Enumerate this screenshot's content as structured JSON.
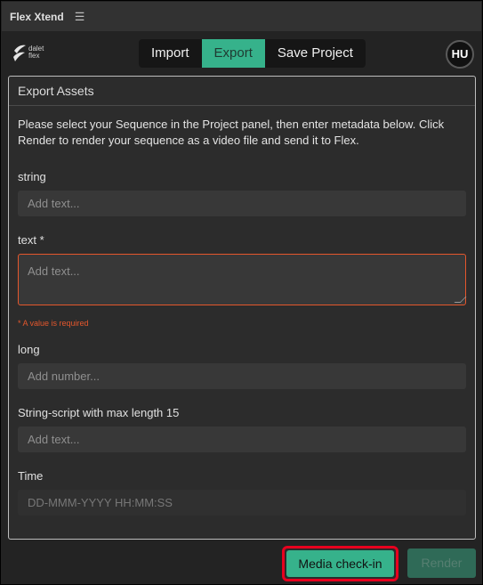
{
  "titlebar": {
    "title": "Flex Xtend",
    "menu_icon": "hamburger-icon"
  },
  "logo": {
    "line1": "dalet",
    "line2": "flex"
  },
  "tabs": [
    {
      "label": "Import",
      "active": false
    },
    {
      "label": "Export",
      "active": true
    },
    {
      "label": "Save Project",
      "active": false
    }
  ],
  "user": {
    "initials": "HU"
  },
  "panel": {
    "title": "Export Assets",
    "intro": "Please select your Sequence in the Project panel, then enter metadata below. Click Render to render your sequence as a video file and send it to Flex."
  },
  "fields": {
    "string": {
      "label": "string",
      "placeholder": "Add text..."
    },
    "text": {
      "label": "text *",
      "placeholder": "Add text...",
      "error": "* A value is required"
    },
    "long": {
      "label": "long",
      "placeholder": "Add number..."
    },
    "string_script": {
      "label": "String-script with max length 15",
      "placeholder": "Add text..."
    },
    "time": {
      "label": "Time",
      "placeholder": "DD-MMM-YYYY HH:MM:SS"
    }
  },
  "actions": {
    "checkin_label": "Media check-in",
    "render_label": "Render"
  },
  "colors": {
    "accent": "#36b28b",
    "error": "#e5572c",
    "highlight": "#e8001e"
  }
}
